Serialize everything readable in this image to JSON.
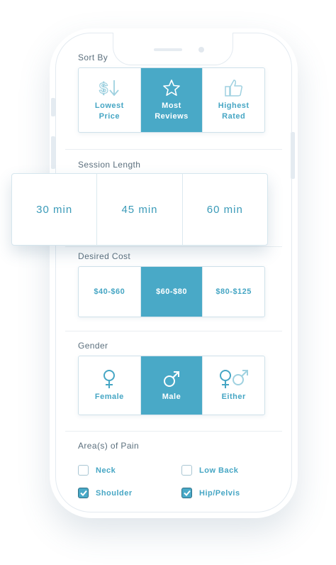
{
  "sort_by": {
    "label": "Sort By",
    "options": [
      {
        "label_line1": "Lowest",
        "label_line2": "Price",
        "icon": "price-sort-icon",
        "active": false
      },
      {
        "label_line1": "Most",
        "label_line2": "Reviews",
        "icon": "star-icon",
        "active": true
      },
      {
        "label_line1": "Highest",
        "label_line2": "Rated",
        "icon": "thumbs-up-icon",
        "active": false
      }
    ]
  },
  "session_length": {
    "label": "Session Length",
    "options": [
      "30 min",
      "45 min",
      "60 min"
    ]
  },
  "desired_cost": {
    "label": "Desired Cost",
    "options": [
      {
        "label": "$40-$60",
        "active": false
      },
      {
        "label": "$60-$80",
        "active": true
      },
      {
        "label": "$80-$125",
        "active": false
      }
    ]
  },
  "gender": {
    "label": "Gender",
    "options": [
      {
        "label": "Female",
        "icon": "female-icon",
        "active": false
      },
      {
        "label": "Male",
        "icon": "male-icon",
        "active": true
      },
      {
        "label": "Either",
        "icon": "either-gender-icon",
        "active": false
      }
    ]
  },
  "pain_areas": {
    "label": "Area(s) of Pain",
    "items": [
      {
        "label": "Neck",
        "checked": false
      },
      {
        "label": "Low Back",
        "checked": false
      },
      {
        "label": "Shoulder",
        "checked": true
      },
      {
        "label": "Hip/Pelvis",
        "checked": true
      }
    ]
  },
  "colors": {
    "accent": "#49a9c7",
    "text_muted": "#5b6f7d"
  }
}
